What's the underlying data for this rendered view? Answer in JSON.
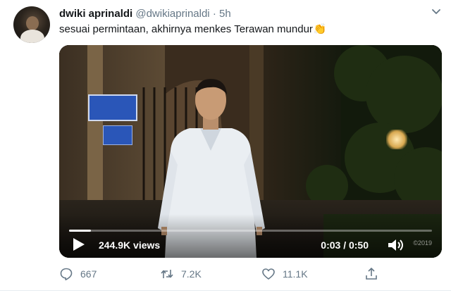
{
  "tweet": {
    "display_name": "dwiki aprinaldi",
    "handle": "@dwikiaprinaldi",
    "separator": "·",
    "time": "5h",
    "text": "sesuai permintaan, akhirnya menkes Terawan mundur",
    "emoji": "👏"
  },
  "video": {
    "views": "244.9K views",
    "time_readout": "0:03 / 0:50",
    "progress": 0.06,
    "watermark": "©2019"
  },
  "actions": {
    "reply_count": "667",
    "retweet_count": "7.2K",
    "like_count": "11.1K"
  },
  "icons": {
    "caret": "chevron-down-icon",
    "play": "play-icon",
    "volume": "volume-muted-icon",
    "reply": "reply-icon",
    "retweet": "retweet-icon",
    "like": "heart-icon",
    "share": "share-icon"
  },
  "colors": {
    "secondary_text": "#657786",
    "primary_text": "#14171a"
  }
}
